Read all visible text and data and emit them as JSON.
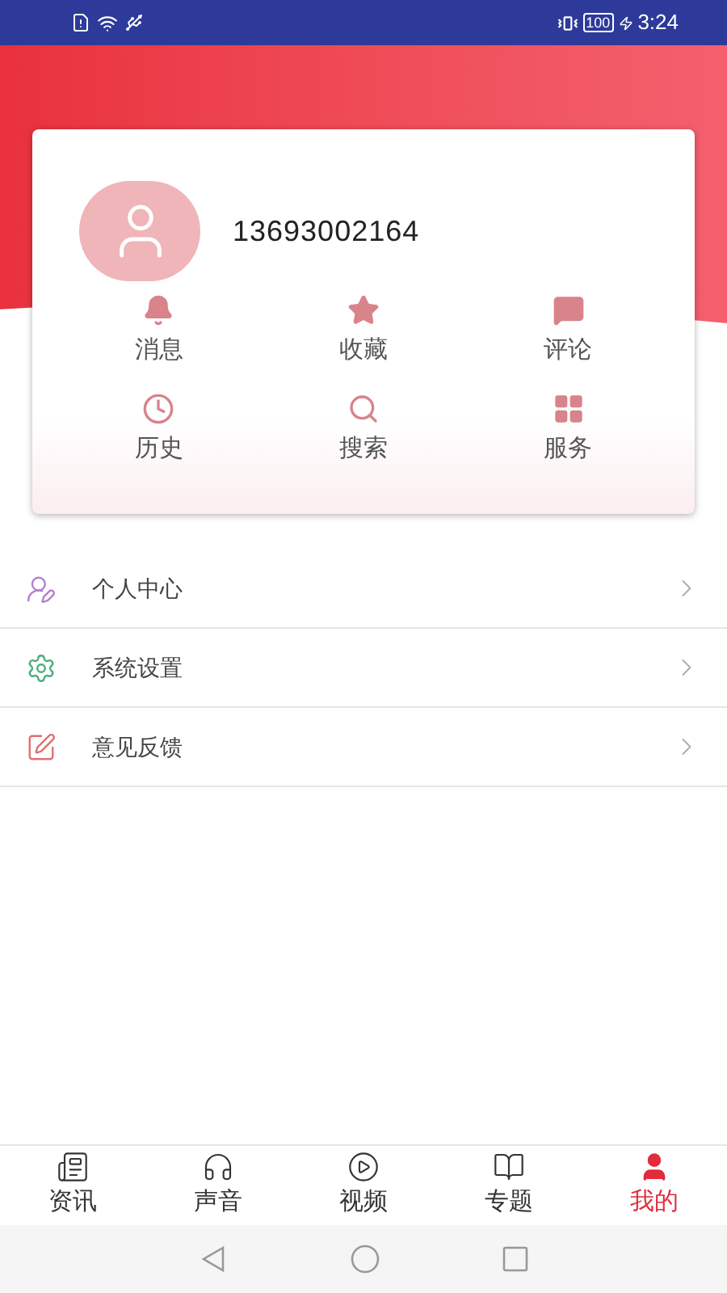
{
  "status_bar": {
    "battery": "100",
    "time": "3:24"
  },
  "profile": {
    "phone": "13693002164"
  },
  "shortcuts": [
    {
      "kind": "bell",
      "label": "消息"
    },
    {
      "kind": "star",
      "label": "收藏"
    },
    {
      "kind": "comment",
      "label": "评论"
    },
    {
      "kind": "clock",
      "label": "历史"
    },
    {
      "kind": "search",
      "label": "搜索"
    },
    {
      "kind": "grid",
      "label": "服务"
    }
  ],
  "menu": [
    {
      "kind": "profile",
      "label": "个人中心",
      "color": "#b57ed0"
    },
    {
      "kind": "settings",
      "label": "系统设置",
      "color": "#4caf7a"
    },
    {
      "kind": "feedback",
      "label": "意见反馈",
      "color": "#e07070"
    }
  ],
  "tabs": [
    {
      "kind": "news",
      "label": "资讯",
      "selected": false
    },
    {
      "kind": "audio",
      "label": "声音",
      "selected": false
    },
    {
      "kind": "video",
      "label": "视频",
      "selected": false
    },
    {
      "kind": "topic",
      "label": "专题",
      "selected": false
    },
    {
      "kind": "me",
      "label": "我的",
      "selected": true
    }
  ]
}
